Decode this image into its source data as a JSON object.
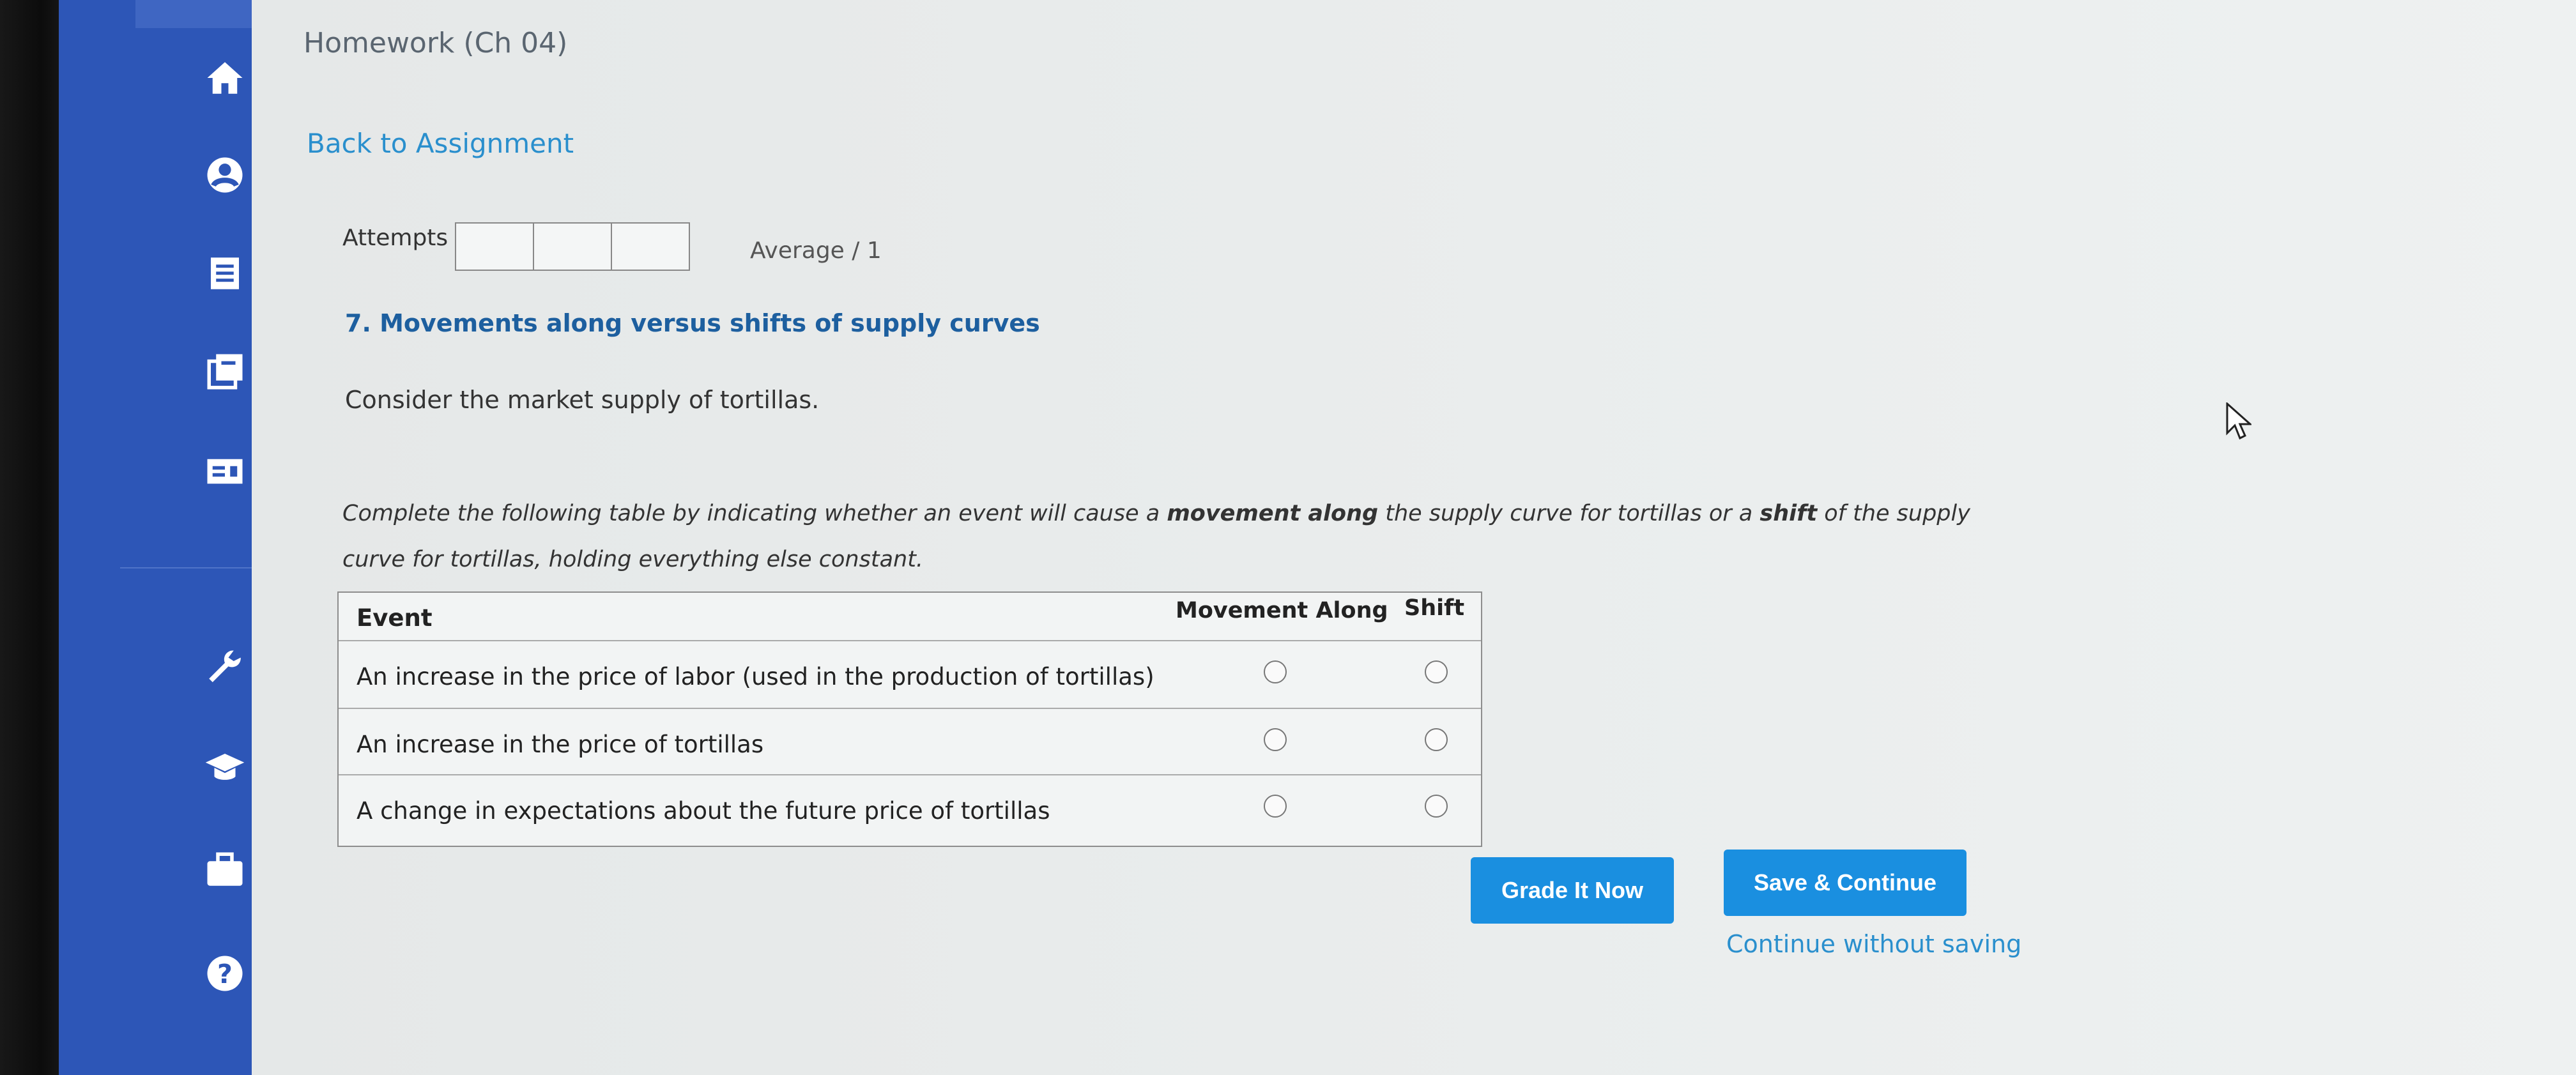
{
  "header": {
    "title": "Homework (Ch 04)",
    "back_link": "Back to Assignment"
  },
  "attempts": {
    "label": "Attempts",
    "boxes": 3,
    "average": "Average / 1"
  },
  "question": {
    "title": "7. Movements along versus shifts of supply curves",
    "intro": "Consider the market supply of tortillas.",
    "instructions": {
      "part1": "Complete the following table by indicating whether an event will cause a",
      "bold1": "movement along",
      "part2": "the supply curve for tortillas or a",
      "bold2": "shift",
      "part3": "of the supply curve for tortillas, holding everything else constant."
    }
  },
  "table": {
    "headers": {
      "event": "Event",
      "movement": "Movement Along",
      "shift": "Shift"
    },
    "rows": [
      {
        "event": "An increase in the price of labor (used in the production of tortillas)"
      },
      {
        "event": "An increase in the price of tortillas"
      },
      {
        "event": "A change in expectations about the future price of tortillas"
      }
    ]
  },
  "actions": {
    "grade": "Grade It Now",
    "save": "Save & Continue",
    "continue": "Continue without saving"
  },
  "sidebar_icons": [
    "home-icon",
    "profile-icon",
    "document-icon",
    "books-icon",
    "card-icon",
    "wrench-icon",
    "graduation-cap-icon",
    "briefcase-icon",
    "help-icon"
  ],
  "colors": {
    "sidebar": "#2d56b7",
    "accent": "#1a8fe0",
    "link": "#2a8fcd",
    "question_title": "#1d5f9f"
  }
}
